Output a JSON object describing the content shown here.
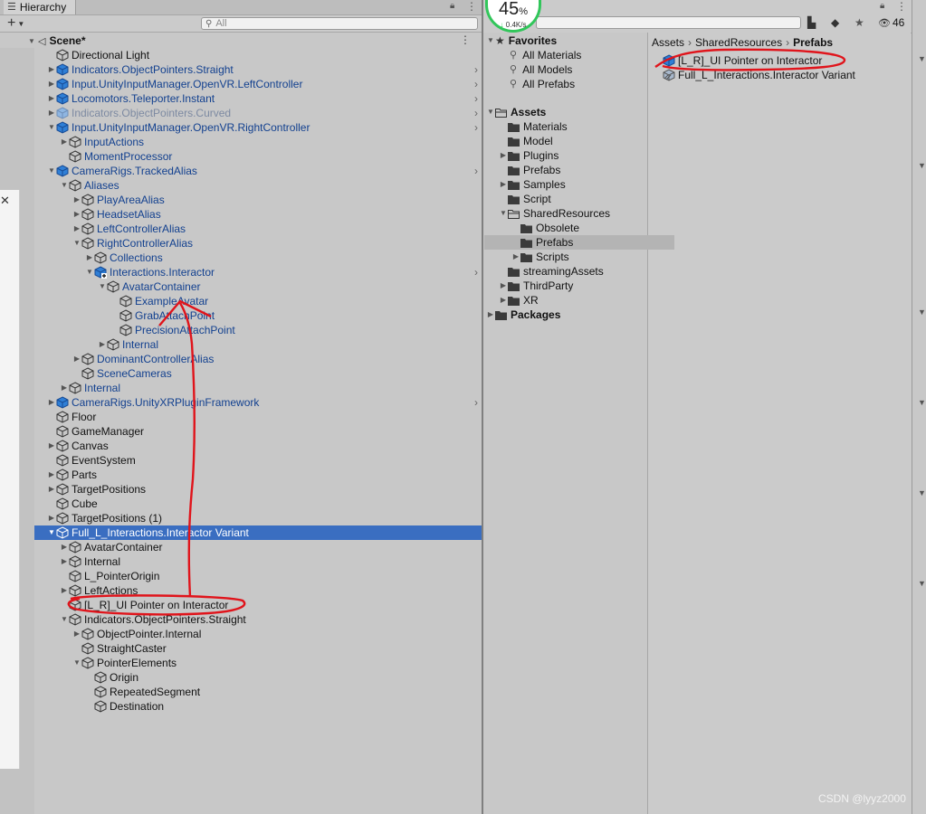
{
  "hierarchy": {
    "tab_label": "Hierarchy",
    "search_placeholder": "All",
    "scene_name": "Scene*",
    "rows": [
      {
        "label": "Directional Light",
        "indent": 0,
        "expand": "none",
        "icon": "gray",
        "style": "normal"
      },
      {
        "label": "Indicators.ObjectPointers.Straight",
        "indent": 0,
        "expand": "right",
        "icon": "blue",
        "style": "blue",
        "chevron": true
      },
      {
        "label": "Input.UnityInputManager.OpenVR.LeftController",
        "indent": 0,
        "expand": "right",
        "icon": "blue",
        "style": "blue",
        "chevron": true
      },
      {
        "label": "Locomotors.Teleporter.Instant",
        "indent": 0,
        "expand": "right",
        "icon": "blue",
        "style": "blue",
        "chevron": true
      },
      {
        "label": "Indicators.ObjectPointers.Curved",
        "indent": 0,
        "expand": "right",
        "icon": "faded",
        "style": "faded",
        "chevron": true
      },
      {
        "label": "Input.UnityInputManager.OpenVR.RightController",
        "indent": 0,
        "expand": "down",
        "icon": "blue",
        "style": "blue",
        "chevron": true
      },
      {
        "label": "InputActions",
        "indent": 1,
        "expand": "right",
        "icon": "gray",
        "style": "blue"
      },
      {
        "label": "MomentProcessor",
        "indent": 1,
        "expand": "none",
        "icon": "gray",
        "style": "blue"
      },
      {
        "label": "CameraRigs.TrackedAlias",
        "indent": 0,
        "expand": "down",
        "icon": "blue",
        "style": "blue",
        "chevron": true
      },
      {
        "label": "Aliases",
        "indent": 1,
        "expand": "down",
        "icon": "gray",
        "style": "blue"
      },
      {
        "label": "PlayAreaAlias",
        "indent": 2,
        "expand": "right",
        "icon": "gray",
        "style": "blue"
      },
      {
        "label": "HeadsetAlias",
        "indent": 2,
        "expand": "right",
        "icon": "gray",
        "style": "blue"
      },
      {
        "label": "LeftControllerAlias",
        "indent": 2,
        "expand": "right",
        "icon": "gray",
        "style": "blue"
      },
      {
        "label": "RightControllerAlias",
        "indent": 2,
        "expand": "down",
        "icon": "gray",
        "style": "blue"
      },
      {
        "label": "Collections",
        "indent": 3,
        "expand": "right",
        "icon": "gray",
        "style": "blue"
      },
      {
        "label": "Interactions.Interactor",
        "indent": 3,
        "expand": "down",
        "icon": "bluePlus",
        "style": "blue",
        "chevron": true
      },
      {
        "label": "AvatarContainer",
        "indent": 4,
        "expand": "down",
        "icon": "gray",
        "style": "blue"
      },
      {
        "label": "ExampleAvatar",
        "indent": 5,
        "expand": "none",
        "icon": "gray",
        "style": "blue"
      },
      {
        "label": "GrabAttachPoint",
        "indent": 5,
        "expand": "none",
        "icon": "gray",
        "style": "blue"
      },
      {
        "label": "PrecisionAttachPoint",
        "indent": 5,
        "expand": "none",
        "icon": "gray",
        "style": "blue"
      },
      {
        "label": "Internal",
        "indent": 4,
        "expand": "right",
        "icon": "gray",
        "style": "blue"
      },
      {
        "label": "DominantControllerAlias",
        "indent": 2,
        "expand": "right",
        "icon": "gray",
        "style": "blue"
      },
      {
        "label": "SceneCameras",
        "indent": 2,
        "expand": "none",
        "icon": "gray",
        "style": "blue"
      },
      {
        "label": "Internal",
        "indent": 1,
        "expand": "right",
        "icon": "gray",
        "style": "blue"
      },
      {
        "label": "CameraRigs.UnityXRPluginFramework",
        "indent": 0,
        "expand": "right",
        "icon": "blue",
        "style": "blue",
        "chevron": true
      },
      {
        "label": "Floor",
        "indent": 0,
        "expand": "none",
        "icon": "gray",
        "style": "normal"
      },
      {
        "label": "GameManager",
        "indent": 0,
        "expand": "none",
        "icon": "gray",
        "style": "normal"
      },
      {
        "label": "Canvas",
        "indent": 0,
        "expand": "right",
        "icon": "gray",
        "style": "normal"
      },
      {
        "label": "EventSystem",
        "indent": 0,
        "expand": "none",
        "icon": "gray",
        "style": "normal"
      },
      {
        "label": "Parts",
        "indent": 0,
        "expand": "right",
        "icon": "gray",
        "style": "normal"
      },
      {
        "label": "TargetPositions",
        "indent": 0,
        "expand": "right",
        "icon": "gray",
        "style": "normal"
      },
      {
        "label": "Cube",
        "indent": 0,
        "expand": "none",
        "icon": "gray",
        "style": "normal"
      },
      {
        "label": "TargetPositions (1)",
        "indent": 0,
        "expand": "right",
        "icon": "gray",
        "style": "normal"
      },
      {
        "label": "Full_L_Interactions.Interactor Variant",
        "indent": 0,
        "expand": "down",
        "icon": "gray",
        "style": "selected"
      },
      {
        "label": "AvatarContainer",
        "indent": 1,
        "expand": "right",
        "icon": "gray",
        "style": "normal"
      },
      {
        "label": "Internal",
        "indent": 1,
        "expand": "right",
        "icon": "gray",
        "style": "normal"
      },
      {
        "label": "L_PointerOrigin",
        "indent": 1,
        "expand": "none",
        "icon": "gray",
        "style": "normal"
      },
      {
        "label": "LeftActions",
        "indent": 1,
        "expand": "right",
        "icon": "gray",
        "style": "normal"
      },
      {
        "label": "[L_R]_UI Pointer on Interactor",
        "indent": 1,
        "expand": "none",
        "icon": "gray",
        "style": "normal"
      },
      {
        "label": "Indicators.ObjectPointers.Straight",
        "indent": 1,
        "expand": "down",
        "icon": "gray",
        "style": "normal"
      },
      {
        "label": "ObjectPointer.Internal",
        "indent": 2,
        "expand": "right",
        "icon": "gray",
        "style": "normal"
      },
      {
        "label": "StraightCaster",
        "indent": 2,
        "expand": "none",
        "icon": "gray",
        "style": "normal"
      },
      {
        "label": "PointerElements",
        "indent": 2,
        "expand": "down",
        "icon": "gray",
        "style": "normal"
      },
      {
        "label": "Origin",
        "indent": 3,
        "expand": "none",
        "icon": "gray",
        "style": "normal"
      },
      {
        "label": "RepeatedSegment",
        "indent": 3,
        "expand": "none",
        "icon": "gray",
        "style": "normal"
      },
      {
        "label": "Destination",
        "indent": 3,
        "expand": "none",
        "icon": "gray",
        "style": "normal"
      }
    ]
  },
  "perf_widget": {
    "percent": "45",
    "percent_sign": "%",
    "rate": "0.4K/s"
  },
  "project": {
    "visibility_count": "46",
    "favorites_title": "Favorites",
    "favorites": [
      "All Materials",
      "All Models",
      "All Prefabs"
    ],
    "assets_title": "Assets",
    "tree": [
      {
        "label": "Materials",
        "indent": 1,
        "expand": "none"
      },
      {
        "label": "Model",
        "indent": 1,
        "expand": "none"
      },
      {
        "label": "Plugins",
        "indent": 1,
        "expand": "right"
      },
      {
        "label": "Prefabs",
        "indent": 1,
        "expand": "none"
      },
      {
        "label": "Samples",
        "indent": 1,
        "expand": "right"
      },
      {
        "label": "Script",
        "indent": 1,
        "expand": "none"
      },
      {
        "label": "SharedResources",
        "indent": 1,
        "expand": "down",
        "open": true
      },
      {
        "label": "Obsolete",
        "indent": 2,
        "expand": "none"
      },
      {
        "label": "Prefabs",
        "indent": 2,
        "expand": "none",
        "selected": true
      },
      {
        "label": "Scripts",
        "indent": 2,
        "expand": "right"
      },
      {
        "label": "streamingAssets",
        "indent": 1,
        "expand": "none"
      },
      {
        "label": "ThirdParty",
        "indent": 1,
        "expand": "right"
      },
      {
        "label": "XR",
        "indent": 1,
        "expand": "right"
      }
    ],
    "packages_title": "Packages",
    "breadcrumb": [
      "Assets",
      "SharedResources",
      "Prefabs"
    ],
    "files": [
      {
        "label": "[L_R]_UI Pointer on Interactor",
        "icon": "prefab-blue"
      },
      {
        "label": "Full_L_Interactions.Interactor Variant",
        "icon": "prefab-variant"
      }
    ]
  },
  "watermark": "CSDN @lyyz2000",
  "colors": {
    "selection": "#3a6ec1",
    "prefab_blue": "#12408f",
    "annotation_red": "#e0141b"
  }
}
